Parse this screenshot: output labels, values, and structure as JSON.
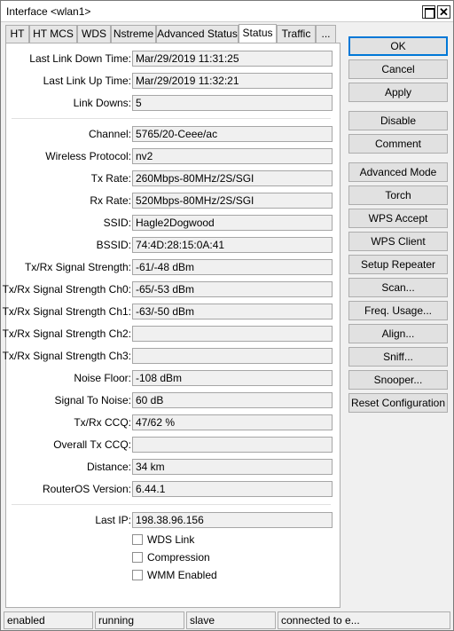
{
  "window": {
    "title": "Interface <wlan1>"
  },
  "tabs": [
    {
      "label": "HT"
    },
    {
      "label": "HT MCS"
    },
    {
      "label": "WDS"
    },
    {
      "label": "Nstreme"
    },
    {
      "label": "Advanced Status"
    },
    {
      "label": "Status",
      "active": true
    },
    {
      "label": "Traffic"
    },
    {
      "label": "..."
    }
  ],
  "fields": {
    "last_link_down_time": {
      "label": "Last Link Down Time:",
      "value": "Mar/29/2019 11:31:25"
    },
    "last_link_up_time": {
      "label": "Last Link Up Time:",
      "value": "Mar/29/2019 11:32:21"
    },
    "link_downs": {
      "label": "Link Downs:",
      "value": "5"
    },
    "channel": {
      "label": "Channel:",
      "value": "5765/20-Ceee/ac"
    },
    "wireless_protocol": {
      "label": "Wireless Protocol:",
      "value": "nv2"
    },
    "tx_rate": {
      "label": "Tx Rate:",
      "value": "260Mbps-80MHz/2S/SGI"
    },
    "rx_rate": {
      "label": "Rx Rate:",
      "value": "520Mbps-80MHz/2S/SGI"
    },
    "ssid": {
      "label": "SSID:",
      "value": "Hagle2Dogwood"
    },
    "bssid": {
      "label": "BSSID:",
      "value": "74:4D:28:15:0A:41"
    },
    "signal_strength": {
      "label": "Tx/Rx Signal Strength:",
      "value": "-61/-48 dBm"
    },
    "signal_ch0": {
      "label": "Tx/Rx Signal Strength Ch0:",
      "value": "-65/-53 dBm"
    },
    "signal_ch1": {
      "label": "Tx/Rx Signal Strength Ch1:",
      "value": "-63/-50 dBm"
    },
    "signal_ch2": {
      "label": "Tx/Rx Signal Strength Ch2:",
      "value": ""
    },
    "signal_ch3": {
      "label": "Tx/Rx Signal Strength Ch3:",
      "value": ""
    },
    "noise_floor": {
      "label": "Noise Floor:",
      "value": "-108 dBm"
    },
    "signal_to_noise": {
      "label": "Signal To Noise:",
      "value": "60 dB"
    },
    "tx_rx_ccq": {
      "label": "Tx/Rx CCQ:",
      "value": "47/62 %"
    },
    "overall_tx_ccq": {
      "label": "Overall Tx CCQ:",
      "value": ""
    },
    "distance": {
      "label": "Distance:",
      "value": "34 km"
    },
    "routeros_version": {
      "label": "RouterOS Version:",
      "value": "6.44.1"
    },
    "last_ip": {
      "label": "Last IP:",
      "value": "198.38.96.156"
    }
  },
  "checkboxes": {
    "wds_link": {
      "label": "WDS Link",
      "checked": false
    },
    "compression": {
      "label": "Compression",
      "checked": false
    },
    "wmm_enabled": {
      "label": "WMM Enabled",
      "checked": false
    }
  },
  "buttons": {
    "ok": "OK",
    "cancel": "Cancel",
    "apply": "Apply",
    "disable": "Disable",
    "comment": "Comment",
    "advanced_mode": "Advanced Mode",
    "torch": "Torch",
    "wps_accept": "WPS Accept",
    "wps_client": "WPS Client",
    "setup_repeater": "Setup Repeater",
    "scan": "Scan...",
    "freq_usage": "Freq. Usage...",
    "align": "Align...",
    "sniff": "Sniff...",
    "snooper": "Snooper...",
    "reset_configuration": "Reset Configuration"
  },
  "statusbar": [
    "enabled",
    "running",
    "slave",
    "connected to e..."
  ]
}
